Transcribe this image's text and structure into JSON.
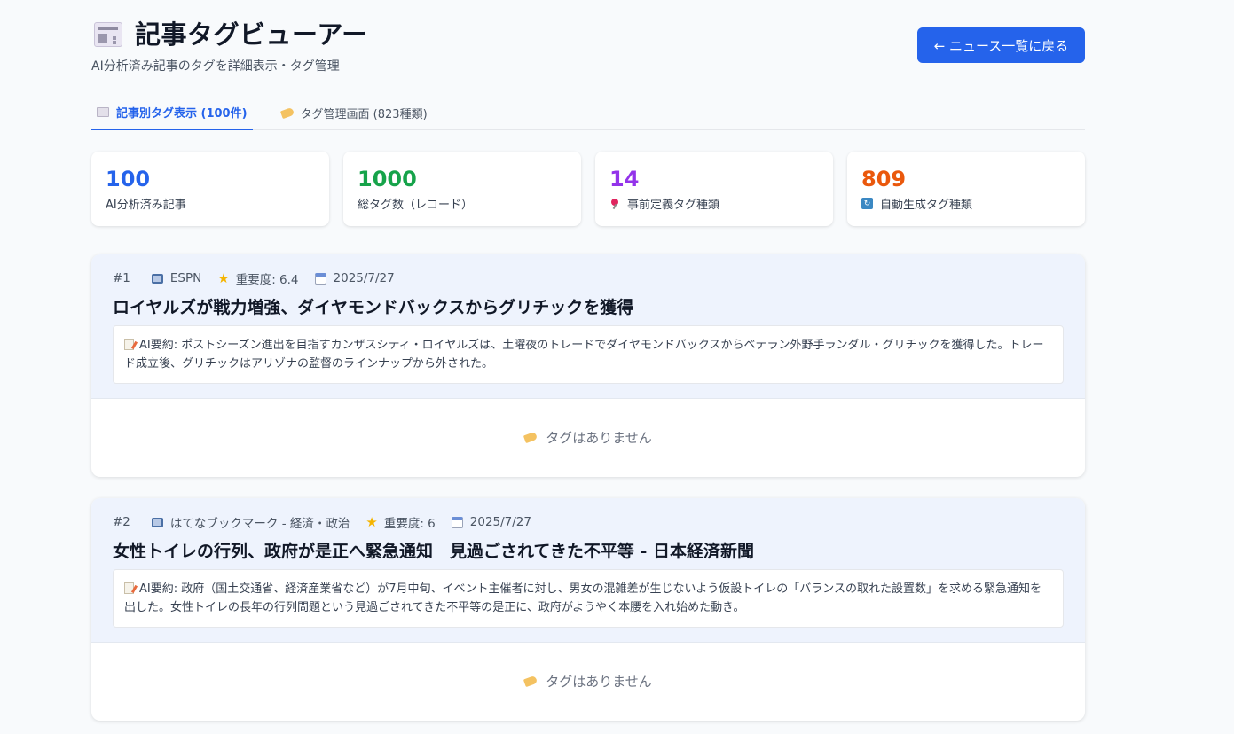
{
  "header": {
    "title": "記事タグビューアー",
    "subtitle": "AI分析済み記事のタグを詳細表示・タグ管理",
    "back_button": "← ニュース一覧に戻る"
  },
  "tabs": [
    {
      "label": "記事別タグ表示 (100件)",
      "active": true
    },
    {
      "label": "タグ管理画面 (823種類)",
      "active": false
    }
  ],
  "stats": [
    {
      "value": "100",
      "label": "AI分析済み記事",
      "color": "#2563eb"
    },
    {
      "value": "1000",
      "label": "総タグ数（レコード）",
      "color": "#16a34a"
    },
    {
      "value": "14",
      "label": "事前定義タグ種類",
      "color": "#9333ea",
      "icon": "pin-icon"
    },
    {
      "value": "809",
      "label": "自動生成タグ種類",
      "color": "#ea580c",
      "icon": "refresh-icon"
    }
  ],
  "articles": [
    {
      "number": "#1",
      "source": "ESPN",
      "importance": "重要度: 6.4",
      "date": "2025/7/27",
      "title": "ロイヤルズが戦力増強、ダイヤモンドバックスからグリチックを獲得",
      "summary": "AI要約: ポストシーズン進出を目指すカンザスシティ・ロイヤルズは、土曜夜のトレードでダイヤモンドバックスからベテラン外野手ランダル・グリチックを獲得した。トレード成立後、グリチックはアリゾナの監督のラインナップから外された。",
      "empty_tags": "タグはありません"
    },
    {
      "number": "#2",
      "source": "はてなブックマーク - 経済・政治",
      "importance": "重要度: 6",
      "date": "2025/7/27",
      "title": "女性トイレの行列、政府が是正へ緊急通知　見過ごされてきた不平等 - 日本経済新聞",
      "summary": "AI要約: 政府（国土交通省、経済産業省など）が7月中旬、イベント主催者に対し、男女の混雑差が生じないよう仮設トイレの「バランスの取れた設置数」を求める緊急通知を出した。女性トイレの長年の行列問題という見過ごされてきた不平等の是正に、政府がようやく本腰を入れ始めた動き。",
      "empty_tags": "タグはありません"
    }
  ]
}
